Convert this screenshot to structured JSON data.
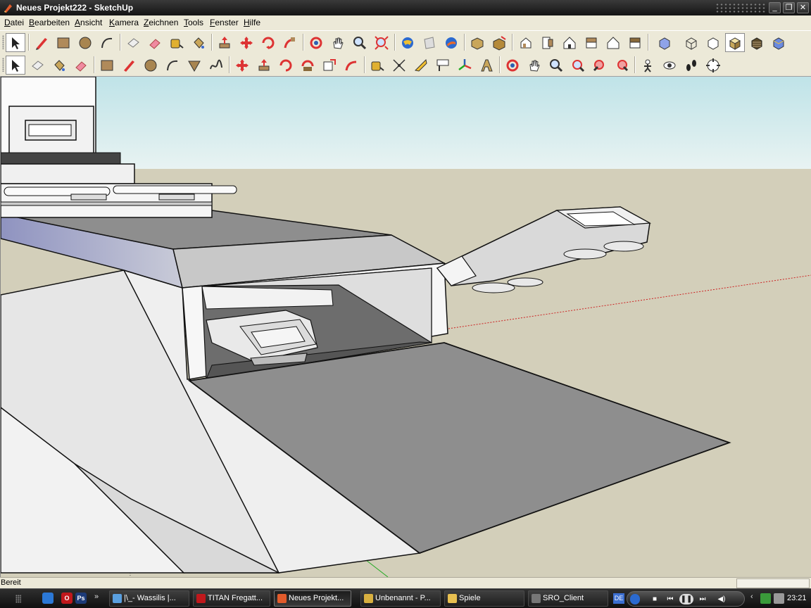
{
  "window": {
    "title": "Neues Projekt222 - SketchUp",
    "minimize_glyph": "_",
    "maximize_glyph": "❐",
    "close_glyph": "✕"
  },
  "menu": {
    "items": [
      "Datei",
      "Bearbeiten",
      "Ansicht",
      "Kamera",
      "Zeichnen",
      "Tools",
      "Fenster",
      "Hilfe"
    ]
  },
  "toolbar1": {
    "icons": [
      "select-arrow-icon",
      "pencil-line-icon",
      "rectangle-icon",
      "circle-icon",
      "arc-icon",
      "eraser-paper-icon",
      "eraser-icon",
      "tape-measure-icon",
      "paint-bucket-icon",
      "push-pull-icon",
      "move-icon",
      "rotate-icon",
      "follow-me-icon",
      "orbit-icon",
      "pan-hand-icon",
      "zoom-icon",
      "zoom-extents-icon",
      "get-models-icon",
      "share-model-icon",
      "google-earth-icon",
      "get-components-icon",
      "share-component-icon",
      "iso-view-icon",
      "top-view-icon",
      "front-view-icon",
      "right-view-icon",
      "back-view-icon",
      "left-view-icon",
      "xray-style-icon",
      "wireframe-style-icon",
      "hidden-line-style-icon",
      "shaded-style-icon",
      "textured-style-icon",
      "monochrome-style-icon"
    ]
  },
  "toolbar2": {
    "icons": [
      "select-arrow-icon",
      "make-component-icon",
      "paint-bucket-icon",
      "eraser-icon",
      "rectangle-icon",
      "pencil-line-icon",
      "circle-icon",
      "arc-icon",
      "polygon-icon",
      "freehand-icon",
      "move-icon",
      "push-pull-icon",
      "rotate-icon",
      "follow-me-icon",
      "scale-icon",
      "offset-icon",
      "tape-measure-icon",
      "dimension-icon",
      "protractor-icon",
      "text-icon",
      "axes-icon",
      "3d-text-icon",
      "orbit-icon",
      "pan-hand-icon",
      "zoom-icon",
      "zoom-window-icon",
      "previous-view-icon",
      "next-view-icon",
      "position-camera-icon",
      "look-around-icon",
      "walk-icon",
      "section-plane-icon"
    ]
  },
  "statusbar": {
    "status": "Bereit",
    "measurements_value": ""
  },
  "taskbar": {
    "quick_launch": [
      "ie-icon",
      "opera-icon",
      "photoshop-icon"
    ],
    "quick_launch_labels": [
      "",
      "O",
      "Ps"
    ],
    "chevron": "»",
    "tasks": [
      {
        "label": "|\\_- Wassilis  |...",
        "icon": "chat-icon",
        "active": false
      },
      {
        "label": "TITAN Fregatt...",
        "icon": "opera-icon",
        "active": false
      },
      {
        "label": "Neues Projekt...",
        "icon": "sketchup-icon",
        "active": true
      },
      {
        "label": "Unbenannt - P...",
        "icon": "paint-icon",
        "active": false
      },
      {
        "label": "Spiele",
        "icon": "folder-icon",
        "active": false
      },
      {
        "label": "SRO_Client",
        "icon": "game-client-icon",
        "active": false
      }
    ],
    "language": "DE",
    "media": {
      "stop": "■",
      "prev": "⏮",
      "pause": "❚❚",
      "next": "⏭",
      "volume": "◀)"
    },
    "tray_chevron": "‹",
    "clock": "23:21"
  },
  "colors": {
    "sky_top": "#bfe3e8",
    "sky_bottom": "#e8f3f2",
    "ground": "#d3cfba",
    "floor_gray": "#8e8e8e",
    "hull_light": "#e4e4e4",
    "deck_blue": "#a7aacb",
    "axis_red": "#cc2222",
    "axis_green": "#22aa22"
  }
}
